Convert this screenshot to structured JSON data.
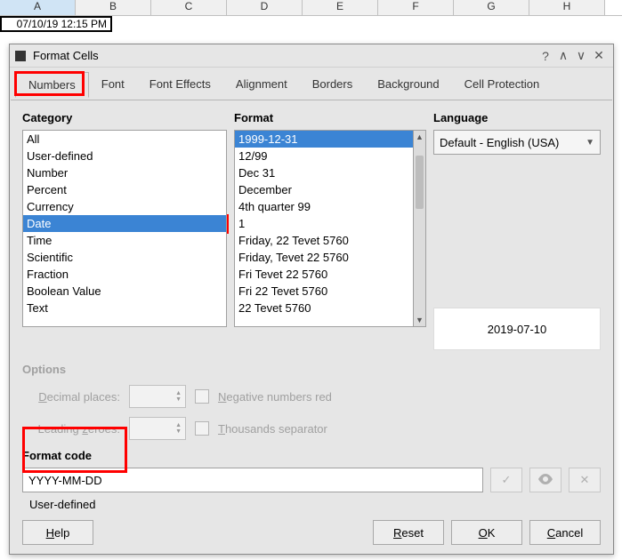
{
  "sheet": {
    "columns": [
      "A",
      "B",
      "C",
      "D",
      "E",
      "F",
      "G",
      "H"
    ],
    "cell_a1": "07/10/19 12:15 PM"
  },
  "dialog": {
    "title": "Format Cells",
    "tabs": [
      "Numbers",
      "Font",
      "Font Effects",
      "Alignment",
      "Borders",
      "Background",
      "Cell Protection"
    ],
    "active_tab": 0,
    "category_label": "Category",
    "categories": [
      "All",
      "User-defined",
      "Number",
      "Percent",
      "Currency",
      "Date",
      "Time",
      "Scientific",
      "Fraction",
      "Boolean Value",
      "Text"
    ],
    "category_selected": 5,
    "format_label": "Format",
    "formats": [
      "1999-12-31",
      "12/99",
      "Dec 31",
      "December",
      "4th quarter 99",
      "1",
      "Friday, 22 Tevet 5760",
      "Friday, Tevet 22 5760",
      "Fri Tevet 22 5760",
      "Fri 22 Tevet 5760",
      "22 Tevet 5760"
    ],
    "format_selected": 0,
    "language_label": "Language",
    "language_value": "Default - English (USA)",
    "preview": "2019-07-10",
    "options_label": "Options",
    "decimal_places_label_pre": "D",
    "decimal_places_label": "ecimal places:",
    "leading_zeroes_label": "Leading ",
    "leading_zeroes_label_ul": "z",
    "leading_zeroes_label_post": "eroes:",
    "negative_red_pre": "N",
    "negative_red": "egative numbers red",
    "thousands_pre": "T",
    "thousands": "housands separator",
    "format_code_label": "Format code",
    "format_code_value": "YYYY-MM-DD",
    "user_defined": "User-defined",
    "buttons": {
      "help": "Help",
      "reset": "Reset",
      "ok": "OK",
      "cancel": "Cancel"
    }
  }
}
